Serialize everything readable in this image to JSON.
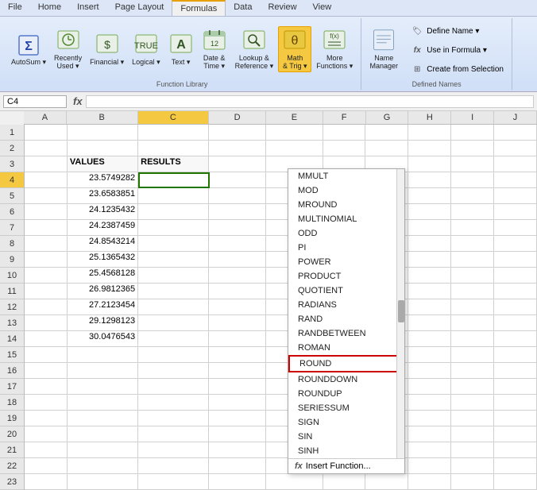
{
  "ribbon": {
    "tabs": [
      "File",
      "Home",
      "Insert",
      "Page Layout",
      "Formulas",
      "Data",
      "Review",
      "View"
    ],
    "active_tab": "Formulas",
    "groups": {
      "function_library": {
        "label": "Function Library",
        "buttons": [
          {
            "id": "autosum",
            "label": "AutoSum",
            "sublabel": "",
            "icon": "Σ"
          },
          {
            "id": "recently",
            "label": "Recently",
            "sublabel": "Used ▾",
            "icon": "🕐"
          },
          {
            "id": "financial",
            "label": "Financial",
            "sublabel": "▾",
            "icon": "💰"
          },
          {
            "id": "logical",
            "label": "Logical",
            "sublabel": "▾",
            "icon": "◈"
          },
          {
            "id": "text",
            "label": "Text",
            "sublabel": "▾",
            "icon": "A"
          },
          {
            "id": "datetime",
            "label": "Date &",
            "sublabel": "Time ▾",
            "icon": "📅"
          },
          {
            "id": "lookup",
            "label": "Lookup &",
            "sublabel": "Reference ▾",
            "icon": "🔍"
          },
          {
            "id": "math",
            "label": "Math",
            "sublabel": "& Trig ▾",
            "icon": "θ"
          },
          {
            "id": "more",
            "label": "More",
            "sublabel": "Functions ▾",
            "icon": "≡"
          }
        ]
      },
      "defined_names": {
        "label": "Defined Names",
        "items": [
          {
            "label": "Name Manager",
            "icon": "📋"
          },
          {
            "label": "Define Name ▾",
            "icon": "🏷"
          },
          {
            "label": "Use in Formula ▾",
            "icon": "fx"
          },
          {
            "label": "Create from Selection",
            "icon": "📌"
          }
        ]
      }
    }
  },
  "formula_bar": {
    "cell_ref": "C4",
    "formula": ""
  },
  "columns": {
    "widths": [
      30,
      60,
      100,
      100,
      80,
      80,
      60,
      60,
      60,
      60,
      60
    ],
    "headers": [
      "",
      "A",
      "B",
      "C",
      "D",
      "E",
      "F",
      "G",
      "H",
      "I",
      "J"
    ]
  },
  "rows": {
    "count": 14,
    "data": [
      {
        "row": 1,
        "B": "",
        "C": "",
        "D": "",
        "E": ""
      },
      {
        "row": 2,
        "B": "",
        "C": "",
        "D": "",
        "E": ""
      },
      {
        "row": 3,
        "B": "VALUES",
        "C": "RESULTS",
        "D": "",
        "E": ""
      },
      {
        "row": 4,
        "B": "23.5749282",
        "C": "",
        "D": "",
        "E": ""
      },
      {
        "row": 5,
        "B": "23.6583851",
        "C": "",
        "D": "",
        "E": ""
      },
      {
        "row": 6,
        "B": "24.1235432",
        "C": "",
        "D": "",
        "E": ""
      },
      {
        "row": 7,
        "B": "24.2387459",
        "C": "",
        "D": "",
        "E": ""
      },
      {
        "row": 8,
        "B": "24.8543214",
        "C": "",
        "D": "",
        "E": ""
      },
      {
        "row": 9,
        "B": "25.1365432",
        "C": "",
        "D": "",
        "E": ""
      },
      {
        "row": 10,
        "B": "25.4568128",
        "C": "",
        "D": "",
        "E": ""
      },
      {
        "row": 11,
        "B": "26.9812365",
        "C": "",
        "D": "",
        "E": ""
      },
      {
        "row": 12,
        "B": "27.2123454",
        "C": "",
        "D": "",
        "E": ""
      },
      {
        "row": 13,
        "B": "29.1298123",
        "C": "",
        "D": "",
        "E": ""
      },
      {
        "row": 14,
        "B": "30.0476543",
        "C": "",
        "D": "",
        "E": ""
      }
    ]
  },
  "dropdown": {
    "items": [
      "MMULT",
      "MOD",
      "MROUND",
      "MULTINOMIAL",
      "ODD",
      "PI",
      "POWER",
      "PRODUCT",
      "QUOTIENT",
      "RADIANS",
      "RAND",
      "RANDBETWEEN",
      "ROMAN",
      "ROUND",
      "ROUNDDOWN",
      "ROUNDUP",
      "SERIESSUM",
      "SIGN",
      "SIN",
      "SINH"
    ],
    "highlighted": "ROUND",
    "footer": "Insert Function..."
  }
}
